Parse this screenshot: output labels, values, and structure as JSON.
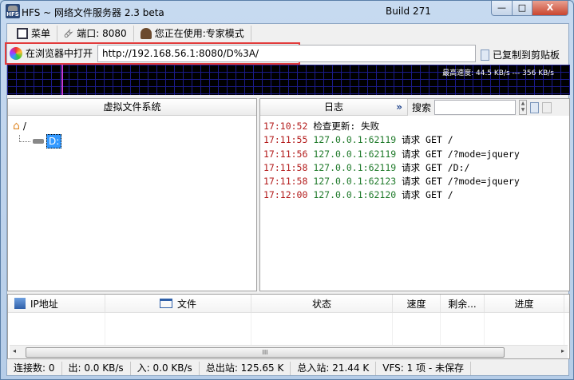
{
  "window": {
    "title": "HFS ~ 网络文件服务器 2.3 beta",
    "build": "Build 271",
    "logo_text": "HFS",
    "minimize": "—",
    "maximize": "□",
    "close": "X"
  },
  "toolbar": {
    "menu": "菜单",
    "port": "端口: 8080",
    "mode": "您正在使用:专家模式"
  },
  "address": {
    "open_label": "在浏览器中打开",
    "url": "http://192.168.56.1:8080/D%3A/",
    "copied": "已复制到剪贴板"
  },
  "graph": {
    "max_speed": "最高速度: 44.5 KB/s --- 356 KB/s"
  },
  "vfs": {
    "header": "虚拟文件系统",
    "root": "/",
    "drive": "D:"
  },
  "log": {
    "header": "日志",
    "expand": "»",
    "search_label": "搜索",
    "search_value": "",
    "entries": [
      {
        "time": "17:10:52",
        "ip": "",
        "msg": "检查更新: 失败"
      },
      {
        "time": "17:11:55",
        "ip": "127.0.0.1:62119",
        "msg": "请求 GET /"
      },
      {
        "time": "17:11:56",
        "ip": "127.0.0.1:62119",
        "msg": "请求 GET /?mode=jquery"
      },
      {
        "time": "17:11:58",
        "ip": "127.0.0.1:62119",
        "msg": "请求 GET /D:/"
      },
      {
        "time": "17:11:58",
        "ip": "127.0.0.1:62123",
        "msg": "请求 GET /?mode=jquery"
      },
      {
        "time": "17:12:00",
        "ip": "127.0.0.1:62120",
        "msg": "请求 GET /"
      }
    ]
  },
  "connections": {
    "columns": [
      "IP地址",
      "文件",
      "状态",
      "速度",
      "剩余...",
      "进度"
    ],
    "scroll_grip": "III"
  },
  "status": [
    "连接数: 0",
    "出: 0.0 KB/s",
    "入: 0.0 KB/s",
    "总出站: 125.65 K",
    "总入站: 21.44 K",
    "VFS: 1 项 - 未保存"
  ]
}
